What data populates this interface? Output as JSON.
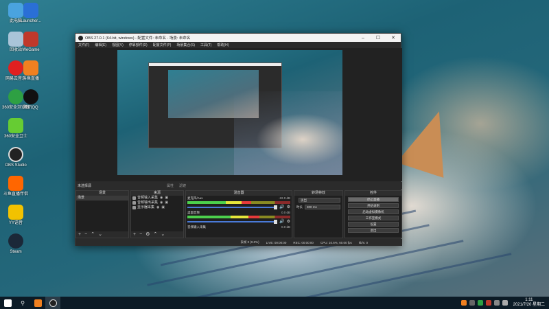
{
  "desktop_icons": [
    {
      "label": "此电脑",
      "color": "#4aa3df"
    },
    {
      "label": "Launcher...",
      "color": "#c0392b"
    },
    {
      "label": "回收站",
      "color": "#bcd"
    },
    {
      "label": "WeGame",
      "color": "#e6b800"
    },
    {
      "label": "网易云音乐",
      "color": "#e02020"
    },
    {
      "label": "斗鱼直播",
      "color": "#f08020"
    },
    {
      "label": "360安全浏览器",
      "color": "#2ea043"
    },
    {
      "label": "腾讯QQ",
      "color": "#111"
    },
    {
      "label": "360安全卫士",
      "color": "#6c3"
    },
    {
      "label": "OBS Studio",
      "color": "#222"
    },
    {
      "label": "斗鱼直播伴侣",
      "color": "#f60"
    },
    {
      "label": "YY语音",
      "color": "#f2c200"
    },
    {
      "label": "Steam",
      "color": "#1b2838"
    }
  ],
  "obs": {
    "title": "OBS 27.0.1 (64-bit, windows) - 配置文件: 未命名 - 场景: 未命名",
    "window_controls": [
      "–",
      "☐",
      "✕"
    ],
    "menu": [
      "文件(F)",
      "编辑(E)",
      "视图(V)",
      "停靠部件(D)",
      "配置文件(P)",
      "场景集合(S)",
      "工具(T)",
      "帮助(H)"
    ],
    "scene_bar": {
      "current": "未选择源",
      "properties": "属性",
      "filters": "滤镜"
    },
    "docks": {
      "scenes": {
        "title": "场景",
        "items": [
          "场景"
        ]
      },
      "sources": {
        "title": "来源",
        "items": [
          "音频输入采集",
          "音频输出采集",
          "显示器采集"
        ]
      },
      "mixer": {
        "title": "混音器",
        "channels": [
          {
            "name": "麦克风/Aux",
            "db": "-22.0 dB",
            "level": 0.62
          },
          {
            "name": "桌面音频",
            "db": "0.0 dB",
            "level": 0.7
          },
          {
            "name": "音频输入采集",
            "db": "0.0 dB",
            "level": 0.0
          }
        ]
      },
      "transitions": {
        "title": "转场特效",
        "type": "淡出",
        "duration_label": "时长",
        "duration": "300 ms"
      },
      "controls": {
        "title": "控件",
        "buttons": [
          "停止直播",
          "开始录制",
          "启动虚拟摄像机",
          "工作室模式",
          "设置",
          "退出"
        ]
      }
    },
    "status": {
      "live": "LIVE: 00:00:00",
      "rec": "REC: 00:00:00",
      "cpu": "CPU: 10.6%, 60.00 fps",
      "dropped": "丢帧 0 (0.0%)",
      "kbps": "kb/s: 0"
    }
  },
  "taskbar": {
    "time": "1:11",
    "date": "2021/7/20 星期二"
  },
  "colors": {
    "obs_bg": "#2b2b2b",
    "accent": "#4a7ad8",
    "taskbar": "#0c1b26"
  }
}
